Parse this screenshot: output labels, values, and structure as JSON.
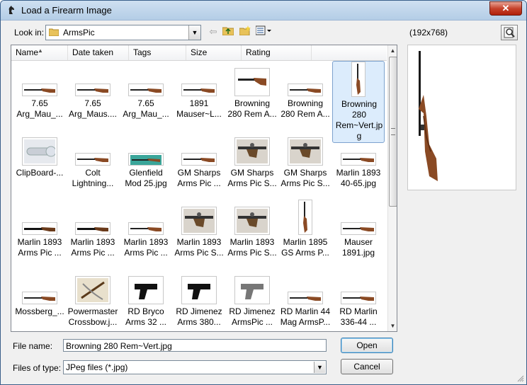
{
  "window": {
    "title": "Load a Firearm Image"
  },
  "toolbar": {
    "look_in_label": "Look in:",
    "look_in_value": "ArmsPic",
    "preview_dims": "(192x768)"
  },
  "columns": [
    "Name",
    "Date taken",
    "Tags",
    "Size",
    "Rating"
  ],
  "items": [
    {
      "caption": "7.65\nArg_Mau_...",
      "thumb": "rifle"
    },
    {
      "caption": "7.65\nArg_Maus....",
      "thumb": "rifle"
    },
    {
      "caption": "7.65\nArg_Mau_...",
      "thumb": "rifle"
    },
    {
      "caption": "1891\nMauser~L...",
      "thumb": "rifle"
    },
    {
      "caption": "Browning\n280 Rem A...",
      "thumb": "rifle-large"
    },
    {
      "caption": "Browning\n280 Rem A...",
      "thumb": "rifle"
    },
    {
      "caption": "Browning\n280\nRem~Vert.jp\ng",
      "thumb": "rifle-vertical",
      "selected": true
    },
    {
      "caption": "ClipBoard-...",
      "thumb": "scope"
    },
    {
      "caption": "Colt\nLightning...",
      "thumb": "rifle"
    },
    {
      "caption": "Glenfield\nMod 25.jpg",
      "thumb": "rifle-teal"
    },
    {
      "caption": "GM Sharps\nArms Pic ...",
      "thumb": "rifle"
    },
    {
      "caption": "GM Sharps\nArms Pic S...",
      "thumb": "action"
    },
    {
      "caption": "GM Sharps\nArms Pic S...",
      "thumb": "action"
    },
    {
      "caption": "Marlin 1893\n40-65.jpg",
      "thumb": "rifle"
    },
    {
      "caption": "Marlin 1893\nArms Pic ...",
      "thumb": "rifle-dark"
    },
    {
      "caption": "Marlin 1893\nArms Pic ...",
      "thumb": "rifle-dark"
    },
    {
      "caption": "Marlin 1893\nArms Pic ...",
      "thumb": "rifle"
    },
    {
      "caption": "Marlin 1893\nArms Pic S...",
      "thumb": "action"
    },
    {
      "caption": "Marlin 1893\nArms Pic S...",
      "thumb": "action"
    },
    {
      "caption": "Marlin 1895\nGS Arms P...",
      "thumb": "rifle-vertical"
    },
    {
      "caption": "Mauser\n1891.jpg",
      "thumb": "rifle"
    },
    {
      "caption": "Mossberg_...",
      "thumb": "rifle"
    },
    {
      "caption": "Powermaster\nCrossbow.j...",
      "thumb": "crossbow"
    },
    {
      "caption": "RD Bryco\nArms 32 ...",
      "thumb": "pistol"
    },
    {
      "caption": "RD Jimenez\nArms 380...",
      "thumb": "pistol"
    },
    {
      "caption": "RD Jimenez\nArmsPic ...",
      "thumb": "pistol-gray"
    },
    {
      "caption": "RD Marlin 44\nMag ArmsP...",
      "thumb": "rifle"
    },
    {
      "caption": "RD Marlin\n336-44 ...",
      "thumb": "rifle"
    }
  ],
  "form": {
    "file_name_label": "File name:",
    "file_name_value": "Browning 280 Rem~Vert.jpg",
    "file_type_label": "Files of type:",
    "file_type_value": "JPeg files (*.jpg)",
    "open_label": "Open",
    "cancel_label": "Cancel"
  }
}
